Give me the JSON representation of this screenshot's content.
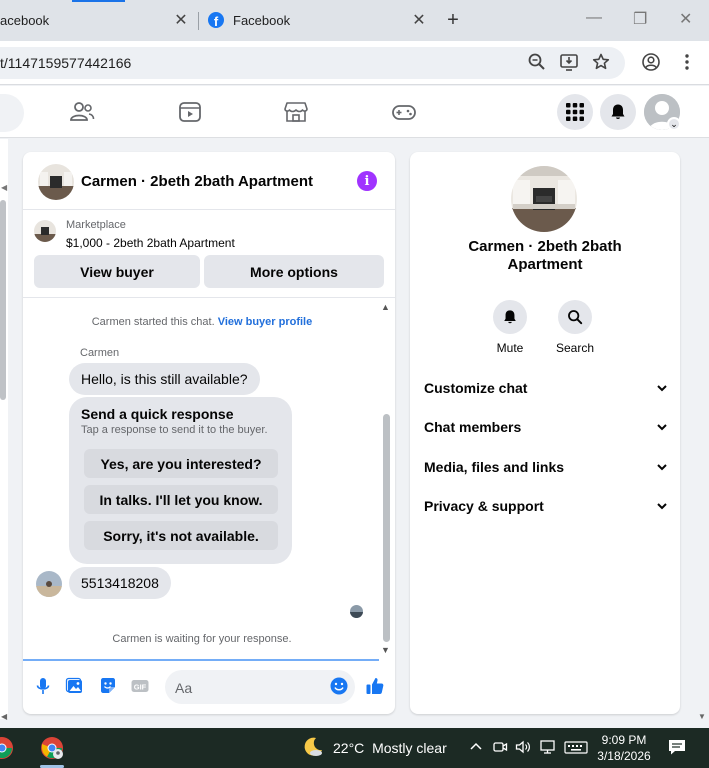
{
  "browser": {
    "tabs": [
      {
        "title": "acebook",
        "close": "✕"
      },
      {
        "title": "Facebook",
        "close": "✕"
      }
    ],
    "new_tab": "+",
    "window_controls": {
      "minimize": "—",
      "maximize": "❐",
      "close": "✕"
    },
    "url": "t/1147159577442166",
    "toolbar_icons": [
      "zoom-icon",
      "install-app-icon",
      "bookmark-star-icon",
      "profile-icon",
      "menu-kebab-icon"
    ]
  },
  "fb_nav": {
    "icons": [
      "friends-icon",
      "watch-icon",
      "marketplace-icon",
      "gaming-icon",
      "menu-grid-icon",
      "notifications-bell-icon",
      "account-avatar"
    ],
    "caret": "⌄"
  },
  "chat": {
    "header_title": "Carmen · 2beth 2bath Apartment",
    "info": "i",
    "marketplace_label": "Marketplace",
    "listing": "$1,000 - 2beth 2bath Apartment",
    "btn_view_buyer": "View buyer",
    "btn_more_options": "More options",
    "started_text": "Carmen started this chat.",
    "view_buyer_profile": "View buyer profile",
    "sender_name": "Carmen",
    "msg_hello": "Hello, is this still available?",
    "quick_title": "Send a quick response",
    "quick_sub": "Tap a response to send it to the buyer.",
    "quick_responses": [
      "Yes, are you interested?",
      "In talks. I'll let you know.",
      "Sorry, it's not available."
    ],
    "msg_phone": "5513418208",
    "waiting_text": "Carmen is waiting for your response.",
    "composer_placeholder": "Aa"
  },
  "side_panel": {
    "title": "Carmen · 2beth 2bath Apartment",
    "actions": [
      {
        "label": "Mute",
        "icon": "bell-icon"
      },
      {
        "label": "Search",
        "icon": "search-icon"
      }
    ],
    "sections": [
      "Customize chat",
      "Chat members",
      "Media, files and links",
      "Privacy & support"
    ]
  },
  "taskbar": {
    "temperature": "22°C",
    "weather": "Mostly clear",
    "time": "9:09 PM",
    "date": "3/18/2026"
  },
  "colors": {
    "accent": "#1877f2",
    "info_purple": "#a033ff",
    "taskbar": "#1c2a24"
  }
}
